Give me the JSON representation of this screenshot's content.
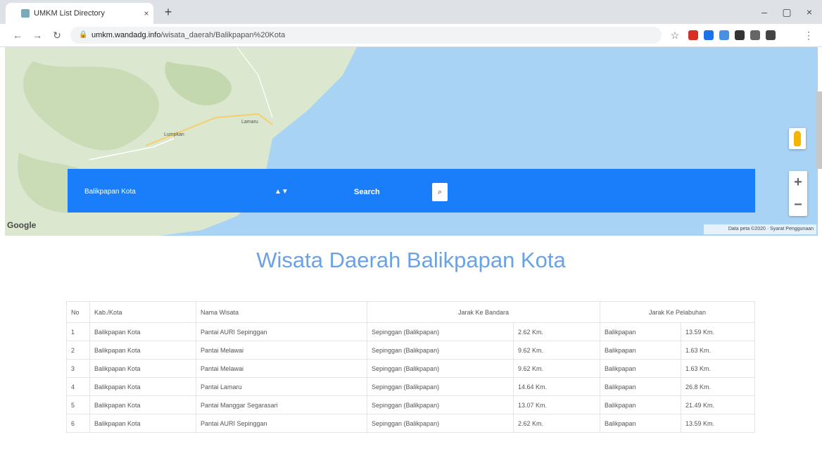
{
  "browser": {
    "tab_title": "UMKM List Directory",
    "tab_close": "×",
    "new_tab": "+",
    "window": {
      "minimize": "–",
      "maximize": "▢",
      "close": "×"
    },
    "nav": {
      "back": "←",
      "forward": "→",
      "reload": "↻"
    },
    "url_host": "umkm.wandadg.info",
    "url_path": "/wisata_daerah/Balikpapan%20Kota",
    "lock": "🔒",
    "star": "☆",
    "menu": "⋮"
  },
  "map": {
    "google_logo": "Google",
    "credits": "Data peta ©2020 · Syarat Penggunaan",
    "place_labels": [
      "Lamaru",
      "Lumpkan"
    ],
    "zoom_in": "+",
    "zoom_out": "−"
  },
  "search": {
    "selected_region": "Balikpapan Kota",
    "select_arrow": "▲▼",
    "label": "Search",
    "button_icon": "⌕"
  },
  "heading": "Wisata Daerah Balikpapan Kota",
  "table": {
    "headers": {
      "no": "No",
      "kab_kota": "Kab./Kota",
      "nama_wisata": "Nama Wisata",
      "jarak_bandara": "Jarak Ke Bandara",
      "jarak_pelabuhan": "Jarak Ke Pelabuhan"
    },
    "rows": [
      [
        "1",
        "Balikpapan Kota",
        "Pantai AURI Sepinggan",
        "Sepinggan (Balikpapan)",
        "2.62 Km.",
        "Balikpapan",
        "13.59 Km."
      ],
      [
        "2",
        "Balikpapan Kota",
        "Pantai Melawai",
        "Sepinggan (Balikpapan)",
        "9.62 Km.",
        "Balikpapan",
        "1.63 Km."
      ],
      [
        "3",
        "Balikpapan Kota",
        "Pantai Melawai",
        "Sepinggan (Balikpapan)",
        "9.62 Km.",
        "Balikpapan",
        "1.63 Km."
      ],
      [
        "4",
        "Balikpapan Kota",
        "Pantai Lamaru",
        "Sepinggan (Balikpapan)",
        "14.64 Km.",
        "Balikpapan",
        "26.8 Km."
      ],
      [
        "5",
        "Balikpapan Kota",
        "Pantai Manggar Segarasari",
        "Sepinggan (Balikpapan)",
        "13.07 Km.",
        "Balikpapan",
        "21.49 Km."
      ],
      [
        "6",
        "Balikpapan Kota",
        "Pantai AURI Sepinggan",
        "Sepinggan (Balikpapan)",
        "2.62 Km.",
        "Balikpapan",
        "13.59 Km."
      ]
    ]
  },
  "colors": {
    "search_bar": "#1a7dfa",
    "heading": "#6aa2e8",
    "water": "#a9d3f5",
    "land": "#dbe7cf"
  }
}
